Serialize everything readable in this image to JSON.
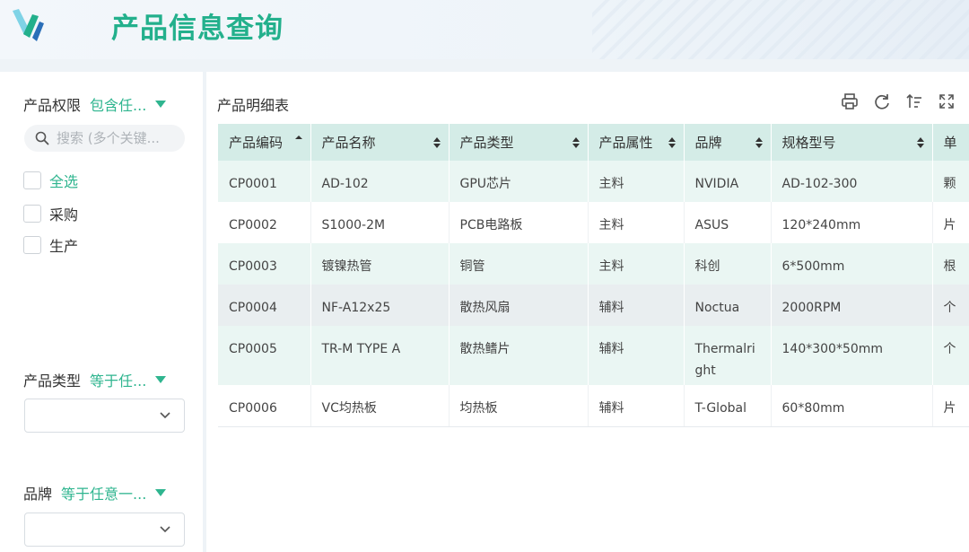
{
  "header": {
    "title": "产品信息查询"
  },
  "colors": {
    "accent": "#23b08c",
    "header_bg": "#d4ece7",
    "row_alt": "#eaf6f3"
  },
  "sidebar": {
    "permission": {
      "label": "产品权限",
      "operator": "包含任..."
    },
    "search": {
      "placeholder": "搜索 (多个关键..."
    },
    "options": [
      {
        "label": "全选",
        "checked": false
      },
      {
        "label": "采购",
        "checked": false
      },
      {
        "label": "生产",
        "checked": false
      }
    ],
    "type_filter": {
      "label": "产品类型",
      "operator": "等于任..."
    },
    "brand_filter": {
      "label": "品牌",
      "operator": "等于任意一..."
    }
  },
  "main": {
    "title": "产品明细表",
    "toolbar": {
      "icons": [
        "print-icon",
        "refresh-icon",
        "sort-icon",
        "fullscreen-icon"
      ]
    },
    "table": {
      "columns": [
        "产品编码",
        "产品名称",
        "产品类型",
        "产品属性",
        "品牌",
        "规格型号",
        "单"
      ],
      "rows": [
        [
          "CP0001",
          "AD-102",
          "GPU芯片",
          "主料",
          "NVIDIA",
          "AD-102-300",
          "颗"
        ],
        [
          "CP0002",
          "S1000-2M",
          "PCB电路板",
          "主料",
          "ASUS",
          "120*240mm",
          "片"
        ],
        [
          "CP0003",
          "镀镍热管",
          "铜管",
          "主料",
          "科创",
          "6*500mm",
          "根"
        ],
        [
          "CP0004",
          "NF-A12x25",
          "散热风扇",
          "辅料",
          "Noctua",
          "2000RPM",
          "个"
        ],
        [
          "CP0005",
          "TR-M TYPE A",
          "散热鳍片",
          "辅料",
          "Thermalright",
          "140*300*50mm",
          "个"
        ],
        [
          "CP0006",
          "VC均热板",
          "均热板",
          "辅料",
          "T-Global",
          "60*80mm",
          "片"
        ]
      ]
    }
  }
}
